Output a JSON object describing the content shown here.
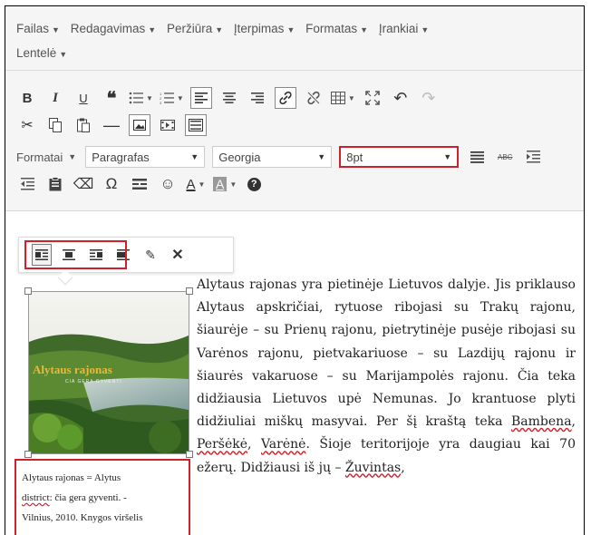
{
  "menu": [
    "Failas",
    "Redagavimas",
    "Peržiūra",
    "Įterpimas",
    "Formatas",
    "Įrankiai",
    "Lentelė"
  ],
  "toolbar": {
    "bold": "B",
    "italic": "I",
    "underline": "U",
    "quote": "❝",
    "formats_label": "Formatai",
    "paragraph_value": "Paragrafas",
    "font_value": "Georgia",
    "font_size_value": "8pt",
    "omega": "Ω",
    "help": "?",
    "text_color_letter": "A",
    "bg_color_letter": "A"
  },
  "image": {
    "title": "Alytaus rajonas",
    "subtitle": "CIA GERA GYVENTI"
  },
  "caption": {
    "line1": "Alytaus rajonas = Alytus",
    "line2_word": "district",
    "line2_rest": ": čia gera gyventi. -",
    "line3": "Vilnius, 2010. Knygos viršelis"
  },
  "body": {
    "p1": "Alytaus rajonas yra pietinėje Lietuvos dalyje. Jis priklauso Alytaus apskričiai, rytuose ribojasi su Trakų rajonu, šiaurėje – su Prienų rajonu, pietrytinėje pusėje ribojasi su Varėnos rajonu, pietvakariuose – su Lazdijų rajonu ir šiaurės vakaruose – su Marijampolės rajonu. Čia teka didžiausia Lietuvos upė Nemunas. Jo krantuose plyti didžiuliai miškų masyvai. Per šį kraštą teka ",
    "river1": "Bambena",
    "sep1": ", ",
    "river2": "Peršėkė",
    "sep2": ", ",
    "river3": "Varėnė",
    "p2": ". Šioje teritorijoje yra daugiau kai 70 ežerų. Didžiausi iš jų – ",
    "lake1": "Žuvintas",
    "p3": ","
  },
  "colors": {
    "highlight": "#d0202a",
    "toolbar_bg": "#f5f5f5"
  }
}
